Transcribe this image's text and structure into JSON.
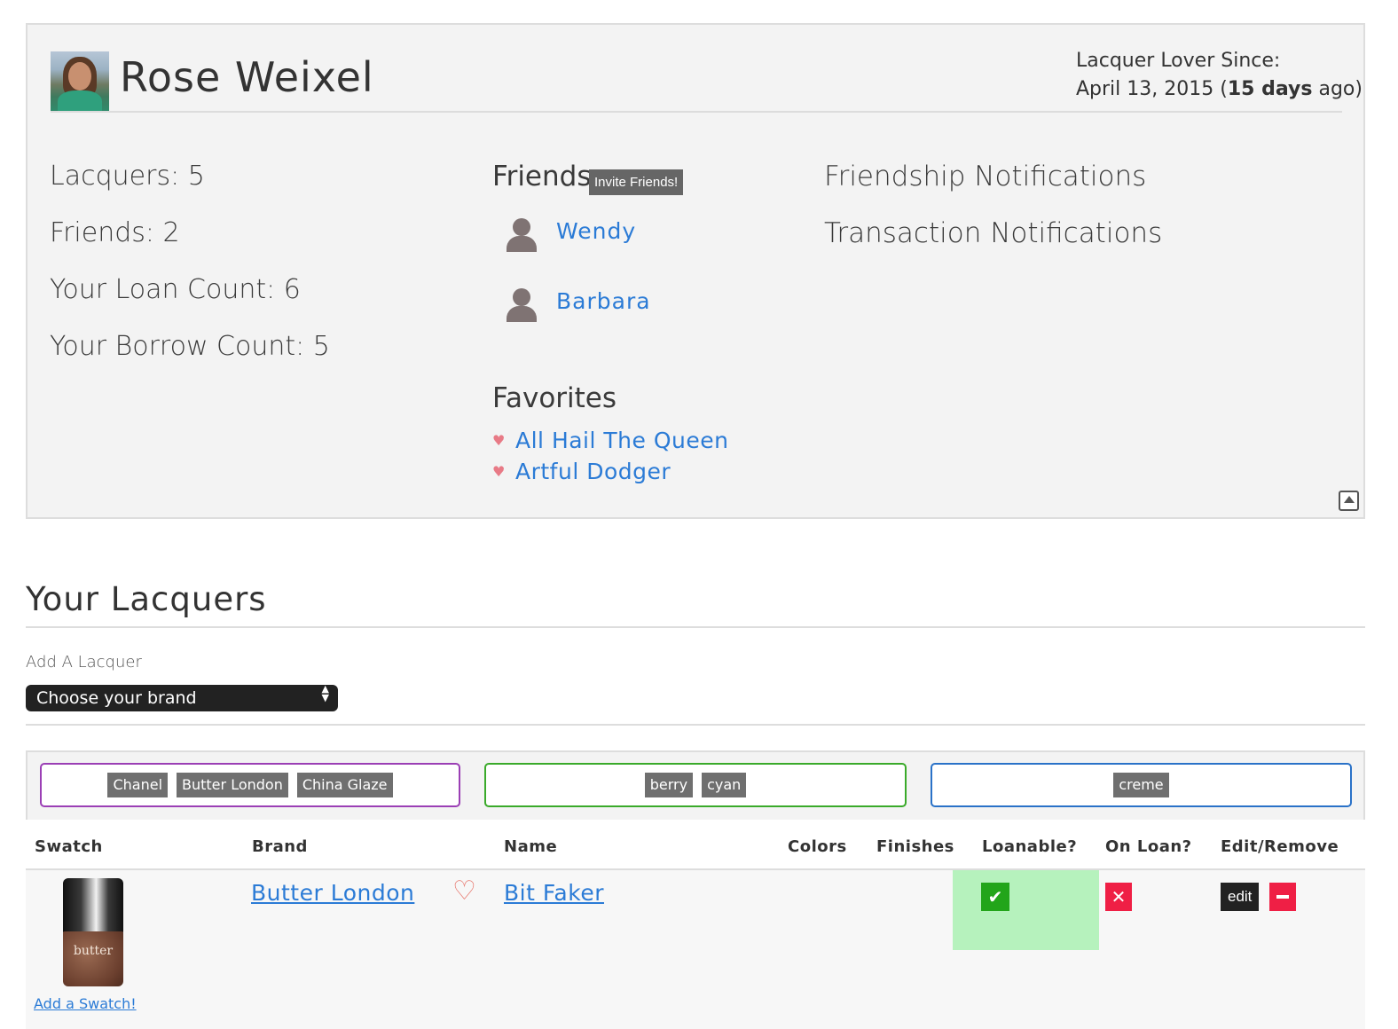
{
  "profile": {
    "name": "Rose Weixel",
    "since_label": "Lacquer Lover Since:",
    "since_date": "April 13, 2015 (",
    "since_days": "15 days",
    "since_suffix": " ago)",
    "stats": {
      "lacquers": "Lacquers: 5",
      "friends": "Friends: 2",
      "loan_count": "Your Loan Count: 6",
      "borrow_count": "Your Borrow Count: 5"
    },
    "friends_heading": "Friends",
    "invite_label": "Invite Friends!",
    "friends": [
      {
        "name": "Wendy"
      },
      {
        "name": "Barbara"
      }
    ],
    "favorites_heading": "Favorites",
    "favorites": [
      {
        "name": "All Hail The Queen"
      },
      {
        "name": "Artful Dodger"
      }
    ],
    "notifications": {
      "friendship": "Friendship Notifications",
      "transaction": "Transaction Notifications"
    }
  },
  "lacquers": {
    "title": "Your Lacquers",
    "add_label": "Add A Lacquer",
    "brand_select": "Choose your brand",
    "filters": {
      "brands": [
        "Chanel",
        "Butter London",
        "China Glaze"
      ],
      "colors": [
        "berry",
        "cyan"
      ],
      "finishes": [
        "creme"
      ]
    },
    "columns": {
      "swatch": "Swatch",
      "brand": "Brand",
      "name": "Name",
      "colors": "Colors",
      "finishes": "Finishes",
      "loanable": "Loanable?",
      "on_loan": "On Loan?",
      "edit_remove": "Edit/Remove"
    },
    "rows": [
      {
        "swatch_text": "butter",
        "add_swatch": "Add a Swatch!",
        "brand": "Butter London",
        "name": "Bit Faker",
        "loanable_icon": "✔",
        "on_loan_icon": "✕",
        "edit_label": "edit"
      }
    ]
  },
  "colors": {
    "link": "#2b7bd6",
    "loanable_bg": "#b6f2bd",
    "check_green": "#22a51a",
    "red": "#ef1f45",
    "brands_filter_border": "#9b3fb5",
    "colors_filter_border": "#3aaa2a",
    "finishes_filter_border": "#2a72c8"
  },
  "icons": {
    "collapse": "collapse-up-icon",
    "heart": "heart-icon",
    "person": "person-icon"
  }
}
